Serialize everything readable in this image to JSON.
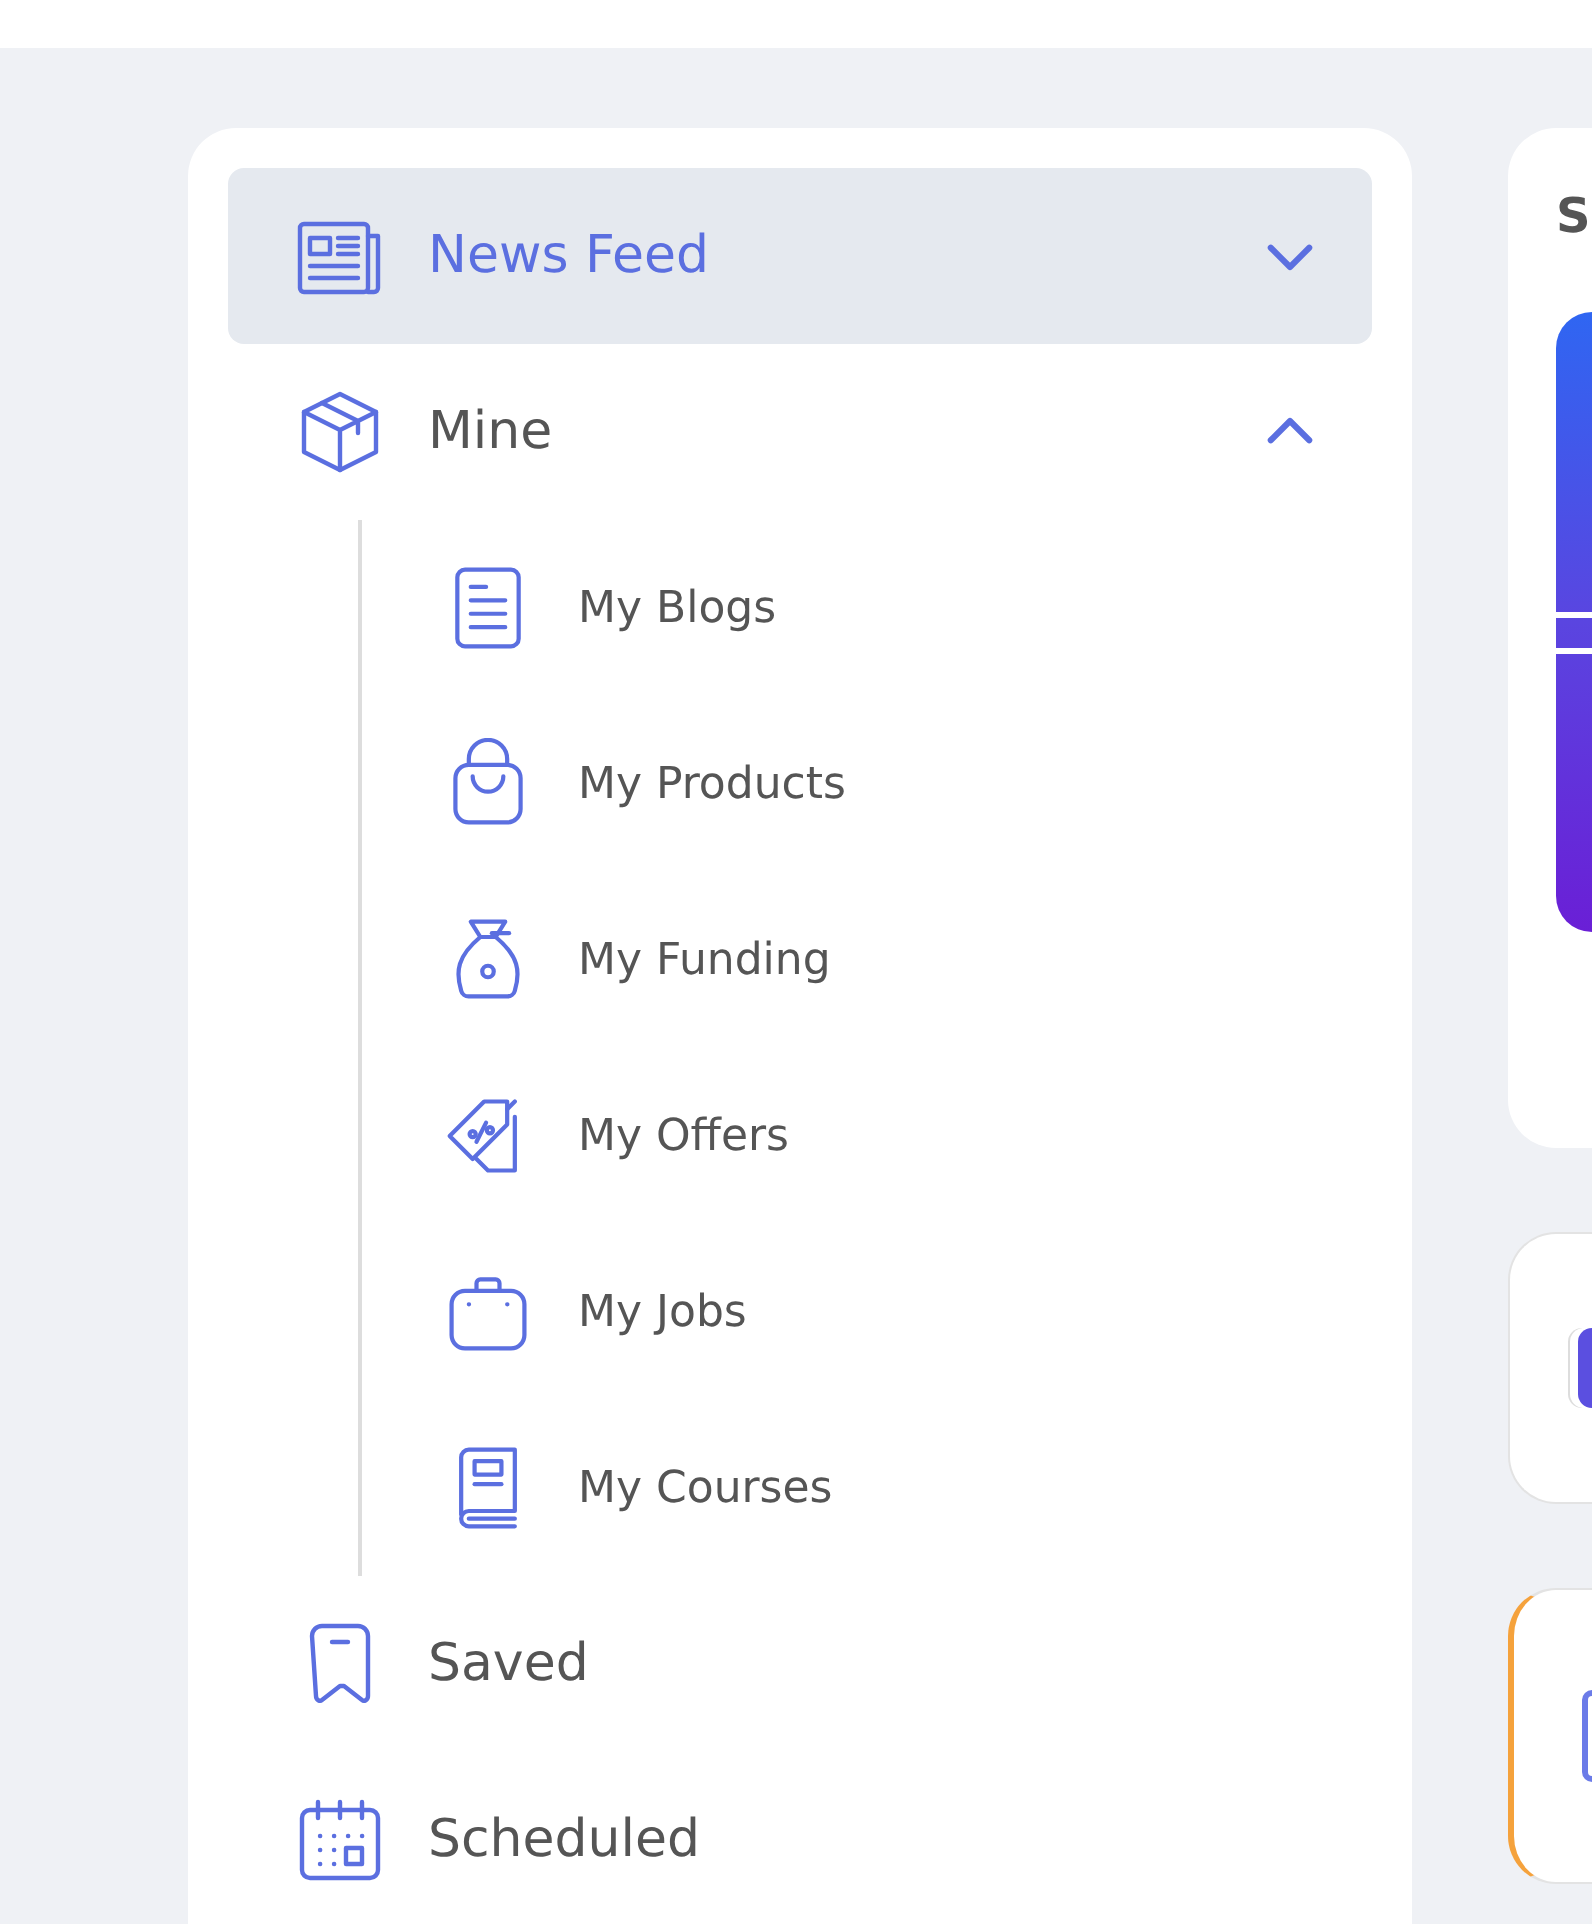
{
  "sidebar": {
    "items": [
      {
        "label": "News Feed",
        "selected": true,
        "expanded": false
      },
      {
        "label": "Mine",
        "selected": false,
        "expanded": true,
        "children": [
          {
            "label": "My Blogs",
            "selected": false
          },
          {
            "label": "My Products",
            "selected": false
          },
          {
            "label": "My Funding",
            "selected": false
          },
          {
            "label": "My Offers",
            "selected": false
          },
          {
            "label": "My Jobs",
            "selected": false
          },
          {
            "label": "My Courses",
            "selected": false
          }
        ]
      },
      {
        "label": "Saved",
        "selected": false
      },
      {
        "label": "Scheduled",
        "selected": false
      }
    ]
  },
  "side_panel": {
    "cards": [
      {
        "kind": "banner",
        "heading": "S"
      },
      {
        "kind": "avatar",
        "highlighted": false
      },
      {
        "kind": "avatar",
        "highlighted": true
      }
    ]
  }
}
